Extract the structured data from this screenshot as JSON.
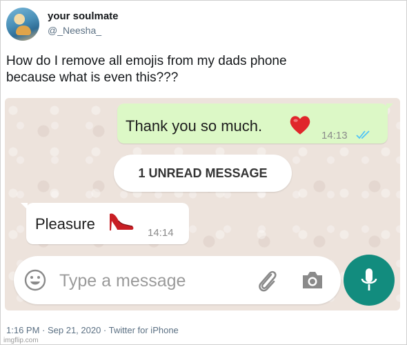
{
  "tweet": {
    "display_name": "your soulmate",
    "handle": "@_Neesha_",
    "text_line1": "How do I remove all emojis from my dads phone",
    "text_line2": "because what is even this???",
    "timestamp": "1:16 PM · Sep 21, 2020 · Twitter for iPhone",
    "watermark": "imgflip.com"
  },
  "chat": {
    "outgoing": {
      "text": "Thank you so much.",
      "emoji": "red-heart-icon",
      "time": "14:13",
      "status": "read-double-check"
    },
    "unread_banner": "1 UNREAD MESSAGE",
    "incoming": {
      "text": "Pleasure",
      "emoji": "high-heel-shoe-icon",
      "time": "14:14"
    },
    "composer": {
      "placeholder": "Type a message"
    },
    "colors": {
      "outgoing_bubble": "#dcf8c6",
      "mic_button": "#128c7e",
      "read_ticks": "#4fc3f7"
    }
  }
}
